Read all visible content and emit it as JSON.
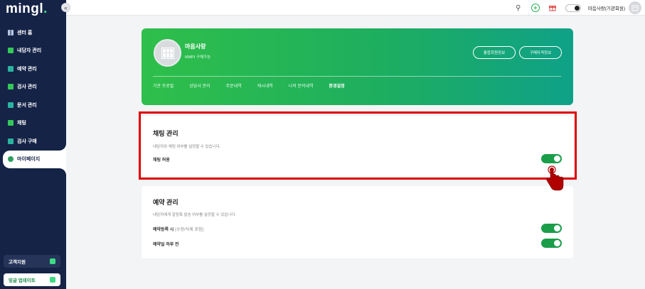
{
  "sidebar": {
    "logo": "mingl",
    "logo_dot": ".",
    "collapse_icon": "«",
    "items": [
      {
        "label": "센터 홈",
        "icon": "grid-icon"
      },
      {
        "label": "내담자 관리",
        "icon": "client-icon"
      },
      {
        "label": "예약 관리",
        "icon": "calendar-icon"
      },
      {
        "label": "검사 관리",
        "icon": "test-icon"
      },
      {
        "label": "문서 관리",
        "icon": "document-icon"
      },
      {
        "label": "채팅",
        "icon": "chat-icon"
      },
      {
        "label": "검사 구매",
        "icon": "cart-icon"
      },
      {
        "label": "마이페이지",
        "icon": "user-icon",
        "active": true
      }
    ],
    "support_label": "고객지원",
    "update_label": "밍글 업데이트"
  },
  "topbar": {
    "search_icon": "⚲",
    "plus_icon": "+",
    "gift_icon": "🎁",
    "user_name": "마음사랑(기관회원)"
  },
  "banner": {
    "name": "마음사랑",
    "subtitle": "MMPI 구매가능",
    "button_1": "통합회원정보",
    "button_2": "구매자격정보",
    "tabs": [
      "기관 프로필",
      "상담사 관리",
      "주문내역",
      "캐시내역",
      "나의 문의내역",
      "환경설정"
    ],
    "active_tab": "환경설정"
  },
  "chat_card": {
    "title": "채팅 관리",
    "description": "내담자와 채팅 여부를 설정할 수 있습니다.",
    "row_label": "채팅 허용",
    "toggle_on": true
  },
  "reservation_card": {
    "title": "예약 관리",
    "description": "내담자에게 알림톡 발송 여부를 설정할 수 있습니다.",
    "row1_label": "예약등록 시",
    "row1_sub": "(수정/삭제 포함)",
    "row2_label": "예약일 하루 전",
    "row1_on": true,
    "row2_on": true
  },
  "colors": {
    "sidebar_bg": "#152347",
    "accent_green": "#1a9e4a",
    "highlight_red": "#e00000"
  }
}
